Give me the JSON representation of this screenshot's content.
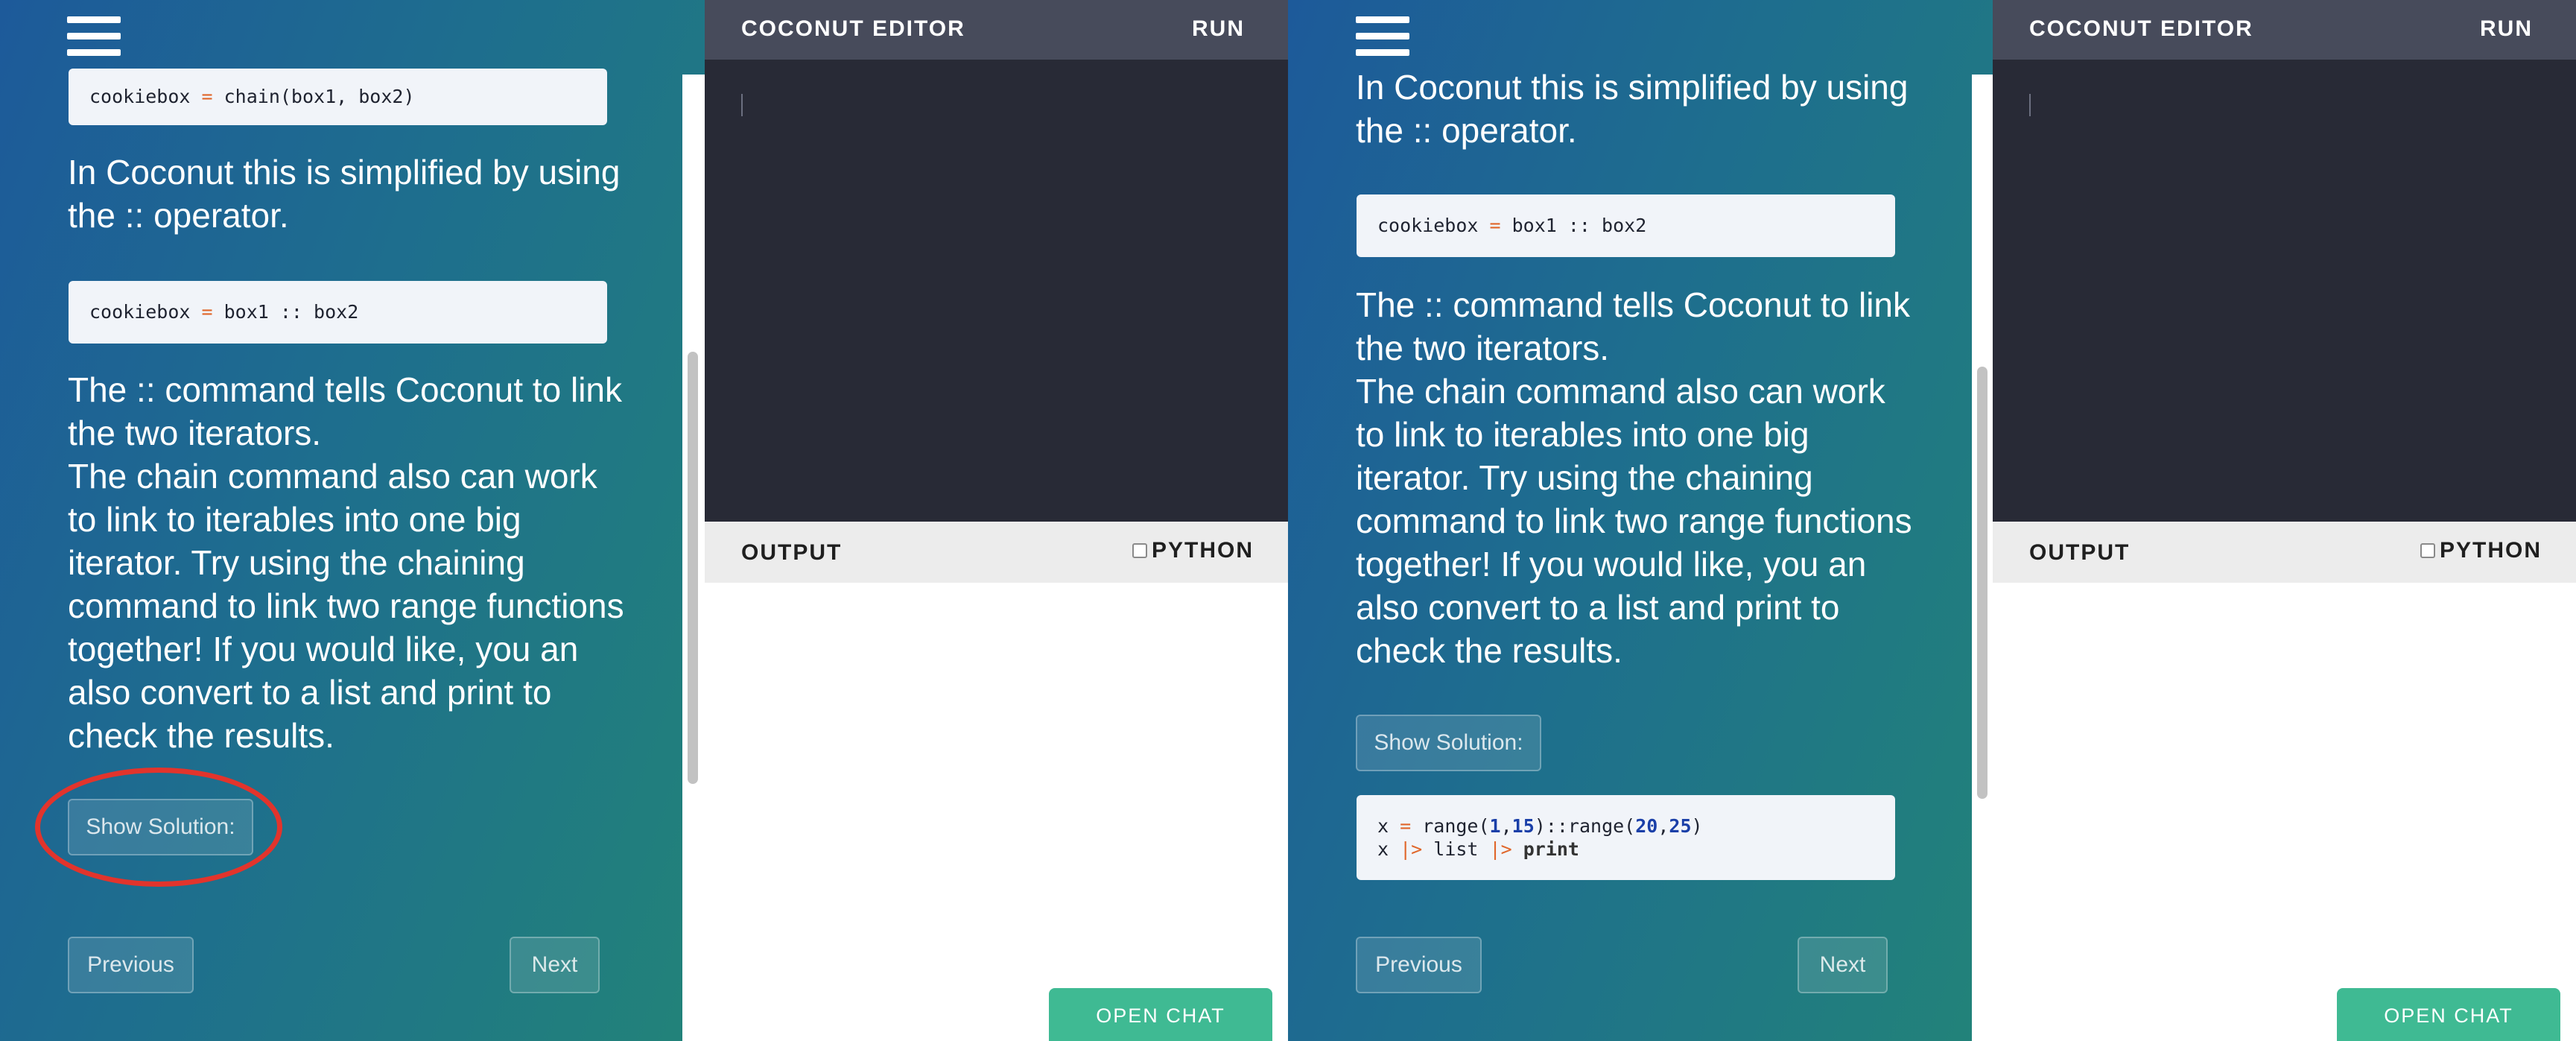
{
  "left_panel": {
    "code_chain": "cookiebox = chain(box1, box2)",
    "intro_text": "In Coconut this is simplified by using the :: operator.",
    "code_colon": "cookiebox = box1 :: box2",
    "body_text": "The :: command tells Coconut to link the two iterators.\nThe chain command also can work to link to iterables into one big iterator. Try using the chaining command to link two range functions together! If you would like, you an also convert to a list and print to check the results.",
    "show_solution": "Show Solution:",
    "previous": "Previous",
    "next": "Next",
    "scroll_level": 0.52
  },
  "right_panel": {
    "intro_text": "In Coconut this is simplified by using the :: operator.",
    "code_colon": "cookiebox = box1 :: box2",
    "body_text": "The :: command tells Coconut to link the two iterators.\nThe chain command also can work to link to iterables into one big iterator. Try using the chaining command to link two range functions together! If you would like, you an also convert to a list and print to check the results.",
    "show_solution": "Show Solution:",
    "solution_line1": "x = range(1,15)::range(20,25)",
    "solution_line2": "x |> list |> print",
    "previous": "Previous",
    "next": "Next",
    "scroll_level": 0.55
  },
  "editor": {
    "title": "COCONUT EDITOR",
    "run": "RUN",
    "output_label": "OUTPUT",
    "python_label": "PYTHON",
    "open_chat": "OPEN CHAT"
  },
  "colors": {
    "highlight_circle": "#e2342c",
    "accent_orange": "#e0662a",
    "open_chat_green": "#3fba93"
  }
}
